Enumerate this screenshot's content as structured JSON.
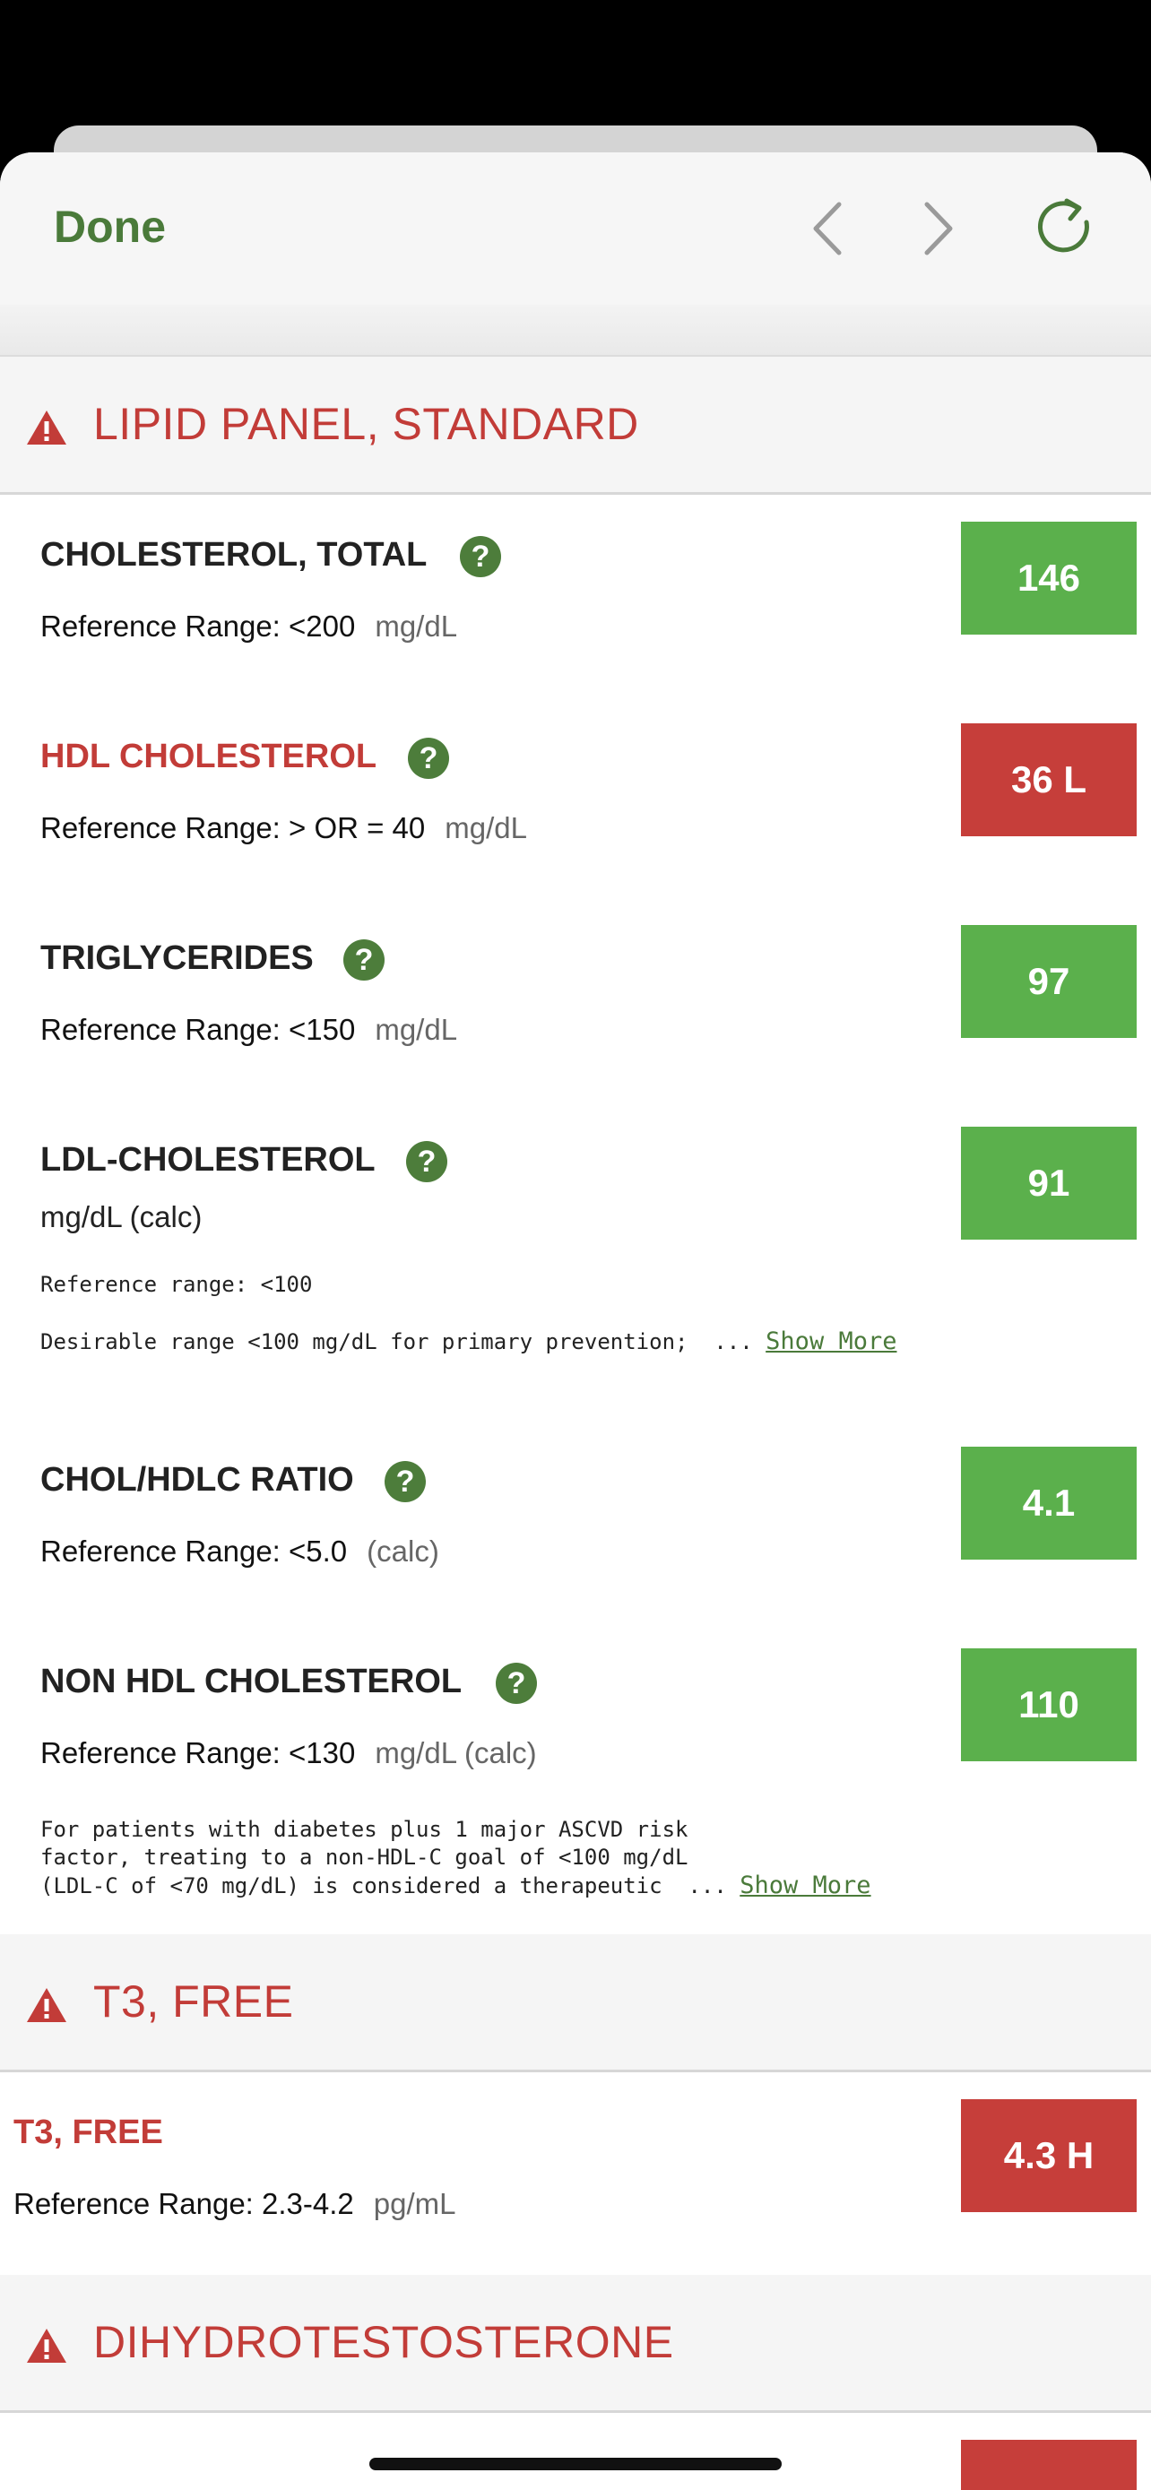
{
  "toolbar": {
    "done_label": "Done"
  },
  "icons": {
    "back": "chevron-left-icon",
    "forward": "chevron-right-icon",
    "reload": "reload-icon",
    "warning": "warning-triangle-icon",
    "help": "question-mark-icon"
  },
  "colors": {
    "accent": "#4a7a3a",
    "abnormal": "#c23c38",
    "normal_result": "#5bb04c",
    "abnormal_result": "#c63e3a"
  },
  "sections": [
    {
      "title": "LIPID PANEL, STANDARD",
      "tests": [
        {
          "name": "CHOLESTEROL, TOTAL",
          "ref_label": "Reference Range: <200",
          "unit": "mg/dL",
          "result": "146"
        },
        {
          "name": "HDL CHOLESTEROL",
          "ref_label": "Reference Range: > OR = 40",
          "unit": "mg/dL",
          "result": "36 L"
        },
        {
          "name": "TRIGLYCERIDES",
          "ref_label": "Reference Range: <150",
          "unit": "mg/dL",
          "result": "97"
        },
        {
          "name": "LDL-CHOLESTEROL",
          "subtitle": "mg/dL (calc)",
          "note_line1": "Reference range: <100",
          "note_line2": "Desirable range <100 mg/dL for primary prevention;  ...",
          "show_more": "Show More",
          "result": "91"
        },
        {
          "name": "CHOL/HDLC RATIO",
          "ref_label": "Reference Range: <5.0",
          "unit": "(calc)",
          "result": "4.1"
        },
        {
          "name": "NON HDL CHOLESTEROL",
          "ref_label": "Reference Range: <130",
          "unit": "mg/dL (calc)",
          "note_line1": "For patients with diabetes plus 1 major ASCVD risk",
          "note_line2": "factor, treating to a non-HDL-C goal of <100 mg/dL",
          "note_line3": "(LDL-C of <70 mg/dL) is considered a therapeutic  ...",
          "show_more": "Show More",
          "result": "110"
        }
      ]
    },
    {
      "title": "T3, FREE",
      "tests": [
        {
          "name": "T3, FREE",
          "ref_label": "Reference Range: 2.3-4.2",
          "unit": "pg/mL",
          "result": "4.3 H"
        }
      ]
    },
    {
      "title": "DIHYDROTESTOSTERONE"
    }
  ]
}
